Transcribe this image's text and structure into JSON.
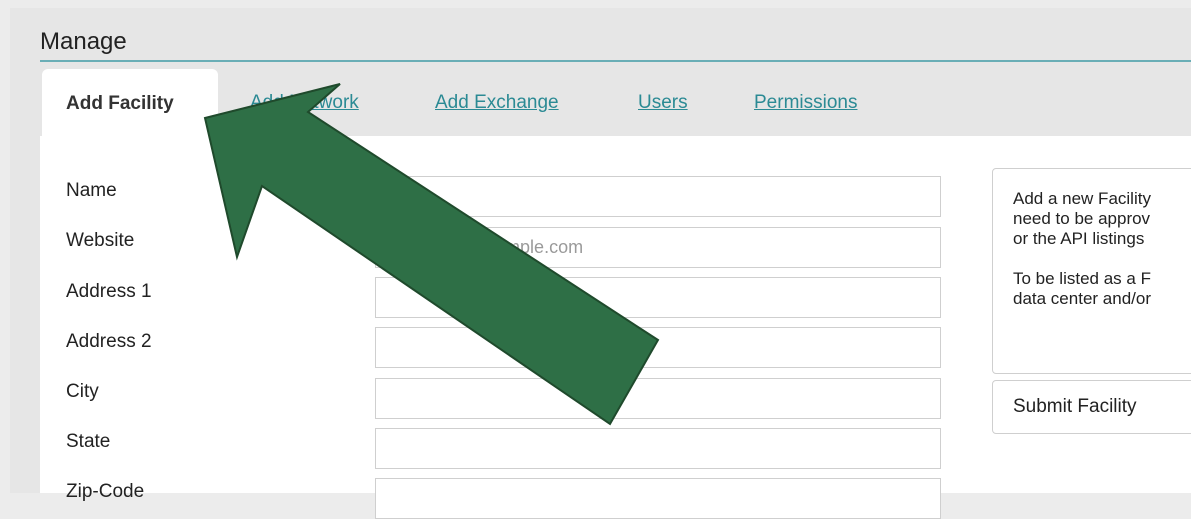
{
  "header": {
    "title": "Manage"
  },
  "tabs": [
    {
      "label": "Add Facility"
    },
    {
      "label": "Add Network"
    },
    {
      "label": "Add Exchange"
    },
    {
      "label": "Users"
    },
    {
      "label": "Permissions"
    }
  ],
  "form": {
    "fields": [
      {
        "label": "Name",
        "placeholder": ""
      },
      {
        "label": "Website",
        "placeholder": "http://www.example.com"
      },
      {
        "label": "Address 1",
        "placeholder": ""
      },
      {
        "label": "Address 2",
        "placeholder": ""
      },
      {
        "label": "City",
        "placeholder": ""
      },
      {
        "label": "State",
        "placeholder": ""
      },
      {
        "label": "Zip-Code",
        "placeholder": ""
      }
    ]
  },
  "info": {
    "paragraph1": [
      "Add a new Facility",
      "need to be approv",
      "or the API listings"
    ],
    "paragraph2": [
      "To be listed as a F",
      "data center and/or"
    ]
  },
  "submit": {
    "label": "Submit Facility"
  },
  "annotation": {
    "arrow_color": "#2e6f46"
  }
}
